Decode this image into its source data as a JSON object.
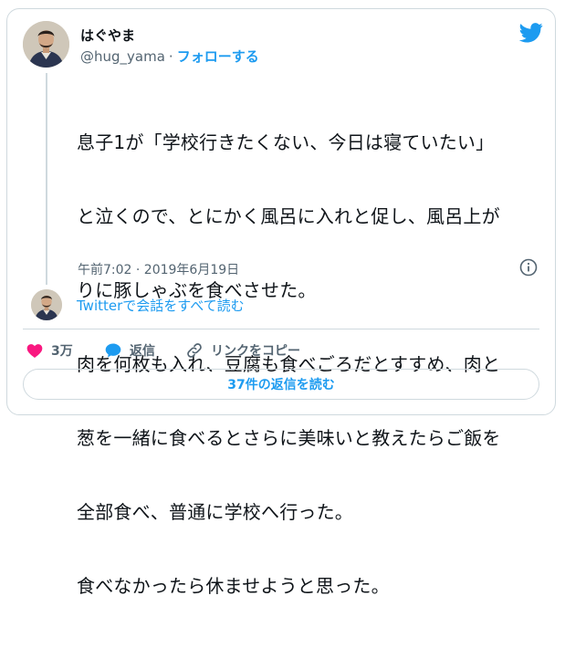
{
  "author": {
    "display_name": "はぐやま",
    "handle": "@hug_yama",
    "separator": "·",
    "follow_label": "フォローする"
  },
  "tweet": {
    "lines": [
      "息子1が「学校行きたくない、今日は寝ていたい」",
      "と泣くので、とにかく風呂に入れと促し、風呂上が",
      "りに豚しゃぶを食べさせた。",
      "肉を何枚も入れ、豆腐も食べごろだとすすめ、肉と",
      "葱を一緒に食べるとさらに美味いと教えたらご飯を",
      "全部食べ、普通に学校へ行った。",
      "食べなかったら休ませようと思った。"
    ],
    "timestamp": "午前7:02 · 2019年6月19日"
  },
  "conversation": {
    "read_label": "Twitterで会話をすべて読む"
  },
  "actions": {
    "like_count": "3万",
    "reply_label": "返信",
    "copy_link_label": "リンクをコピー"
  },
  "footer": {
    "read_replies_label": "37件の返信を読む"
  },
  "colors": {
    "accent": "#1d9bf0",
    "like": "#f91880",
    "muted": "#536471",
    "border": "#cfd9de"
  },
  "icons": [
    "twitter-bird-icon",
    "info-icon",
    "heart-icon",
    "reply-bubble-icon",
    "link-icon"
  ]
}
